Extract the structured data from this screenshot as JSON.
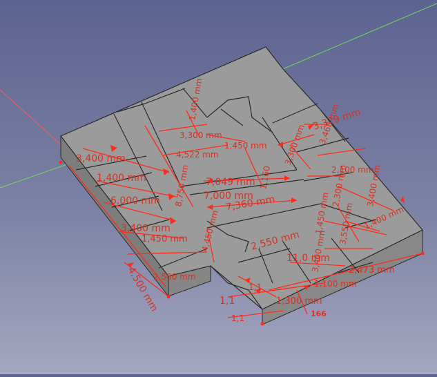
{
  "app": {
    "view": "3D viewport"
  },
  "colors": {
    "background_top": "#5d6390",
    "background_bottom": "#a4a7bf",
    "slab_top": "#9b9b9b",
    "slab_side_left": "#7f7f7f",
    "slab_side_right": "#8a8a8a",
    "wall_line": "#2b2b2b",
    "dimension": "#ff2a1a",
    "axis_x": "#ff5a5a",
    "axis_y": "#6fdc5c"
  },
  "dimensions": [
    {
      "id": "d1",
      "label": "3,379 mm"
    },
    {
      "id": "d2",
      "label": "3,300 mm"
    },
    {
      "id": "d3",
      "label": "3,300 mm"
    },
    {
      "id": "d4",
      "label": "1,400 mm"
    },
    {
      "id": "d5",
      "label": "4,522 mm"
    },
    {
      "id": "d6",
      "label": "1,450 mm"
    },
    {
      "id": "d7",
      "label": "3,468 mm"
    },
    {
      "id": "d8",
      "label": "3,400 mm"
    },
    {
      "id": "d9",
      "label": "1,400 mm"
    },
    {
      "id": "d10",
      "label": "6,000 mm"
    },
    {
      "id": "d11",
      "label": "7,049 mm"
    },
    {
      "id": "d12",
      "label": "7,000 mm"
    },
    {
      "id": "d13",
      "label": "1,160"
    },
    {
      "id": "d14",
      "label": "3,400 mm"
    },
    {
      "id": "d15",
      "label": "8,750 mm"
    },
    {
      "id": "d16",
      "label": "1,450 mm"
    },
    {
      "id": "d17",
      "label": "7,360 mm"
    },
    {
      "id": "d18",
      "label": "4,450 mm"
    },
    {
      "id": "d19",
      "label": "2,550 mm"
    },
    {
      "id": "d20",
      "label": "2,100 mm"
    },
    {
      "id": "d21",
      "label": "3,400 mm"
    },
    {
      "id": "d22",
      "label": "2,300 mm"
    },
    {
      "id": "d23",
      "label": "1,400 mm"
    },
    {
      "id": "d24",
      "label": "1,450 mm"
    },
    {
      "id": "d25",
      "label": "3,550 mm"
    },
    {
      "id": "d26",
      "label": "2,560 mm"
    },
    {
      "id": "d27",
      "label": "4,500 mm"
    },
    {
      "id": "d28",
      "label": "11,0 mm"
    },
    {
      "id": "d29",
      "label": "3,400 mm"
    },
    {
      "id": "d30",
      "label": "1,100 mm"
    },
    {
      "id": "d31",
      "label": "2,473 mm"
    },
    {
      "id": "d32",
      "label": "1,300 mm"
    },
    {
      "id": "d33",
      "label": "1,1"
    },
    {
      "id": "d34",
      "label": "1,1"
    },
    {
      "id": "d35",
      "label": "1,1"
    },
    {
      "id": "d36",
      "label": "166"
    }
  ]
}
